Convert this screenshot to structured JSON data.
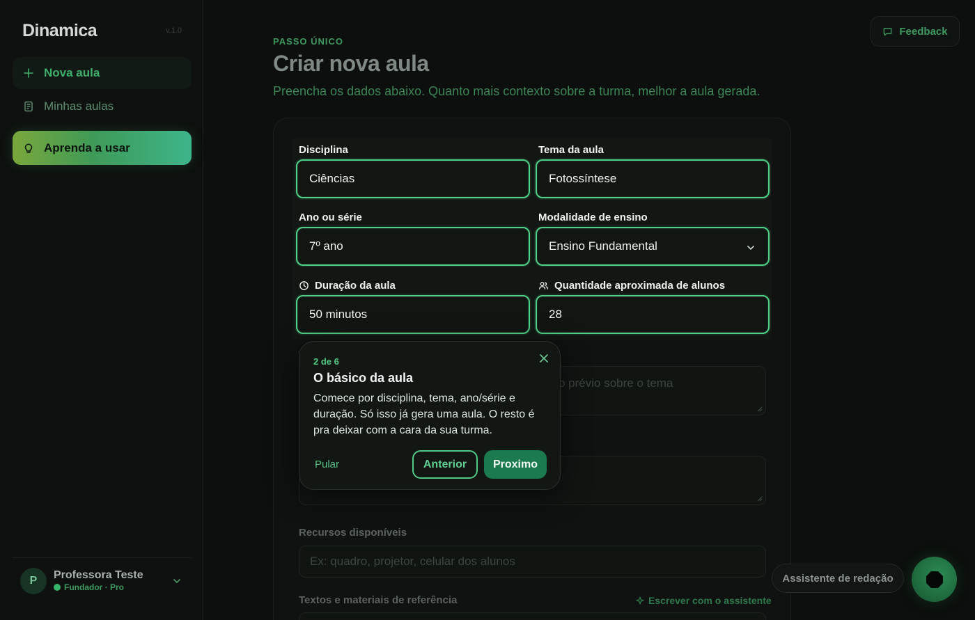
{
  "sidebar": {
    "brand": "Dinamica",
    "version": "v.1.0",
    "nav": [
      {
        "label": "Nova aula",
        "icon": "plus-icon"
      },
      {
        "label": "Minhas aulas",
        "icon": "document-icon"
      },
      {
        "label": "Aprenda a usar",
        "icon": "lightbulb-icon"
      }
    ],
    "user": {
      "initial": "P",
      "name": "Professora Teste",
      "plan": "Fundador · Pro"
    }
  },
  "header": {
    "feedback_label": "Feedback",
    "step_label": "PASSO ÚNICO",
    "title": "Criar nova aula",
    "subtitle": "Preencha os dados abaixo. Quanto mais contexto sobre a turma, melhor a aula gerada."
  },
  "form": {
    "disciplina": {
      "label": "Disciplina",
      "value": "Ciências"
    },
    "tema": {
      "label": "Tema da aula",
      "value": "Fotossíntese"
    },
    "ano": {
      "label": "Ano ou série",
      "value": "7º ano"
    },
    "modalidade": {
      "label": "Modalidade de ensino",
      "value": "Ensino Fundamental"
    },
    "duracao": {
      "label": "Duração da aula",
      "value": "50 minutos"
    },
    "alunos": {
      "label": "Quantidade aproximada de alunos",
      "value": "28"
    },
    "conhecimento_placeholder_fragment": "o prévio sobre o tema",
    "recursos": {
      "label": "Recursos disponíveis",
      "placeholder": "Ex: quadro, projetor, celular dos alunos"
    },
    "textos": {
      "label": "Textos e materiais de referência",
      "assist_link": "Escrever com o assistente"
    }
  },
  "tour": {
    "step": "2 de 6",
    "title": "O básico da aula",
    "body": "Comece por disciplina, tema, ano/série e duração. Só isso já gera uma aula. O resto é pra deixar com a cara da sua turma.",
    "skip": "Pular",
    "prev": "Anterior",
    "next": "Proximo"
  },
  "assistant": {
    "label": "Assistente de redação"
  },
  "colors": {
    "accent": "#4fd087",
    "brand_green": "#3f9a5f",
    "background": "#0c0f0d",
    "primary_button": "#1b7a4e"
  }
}
